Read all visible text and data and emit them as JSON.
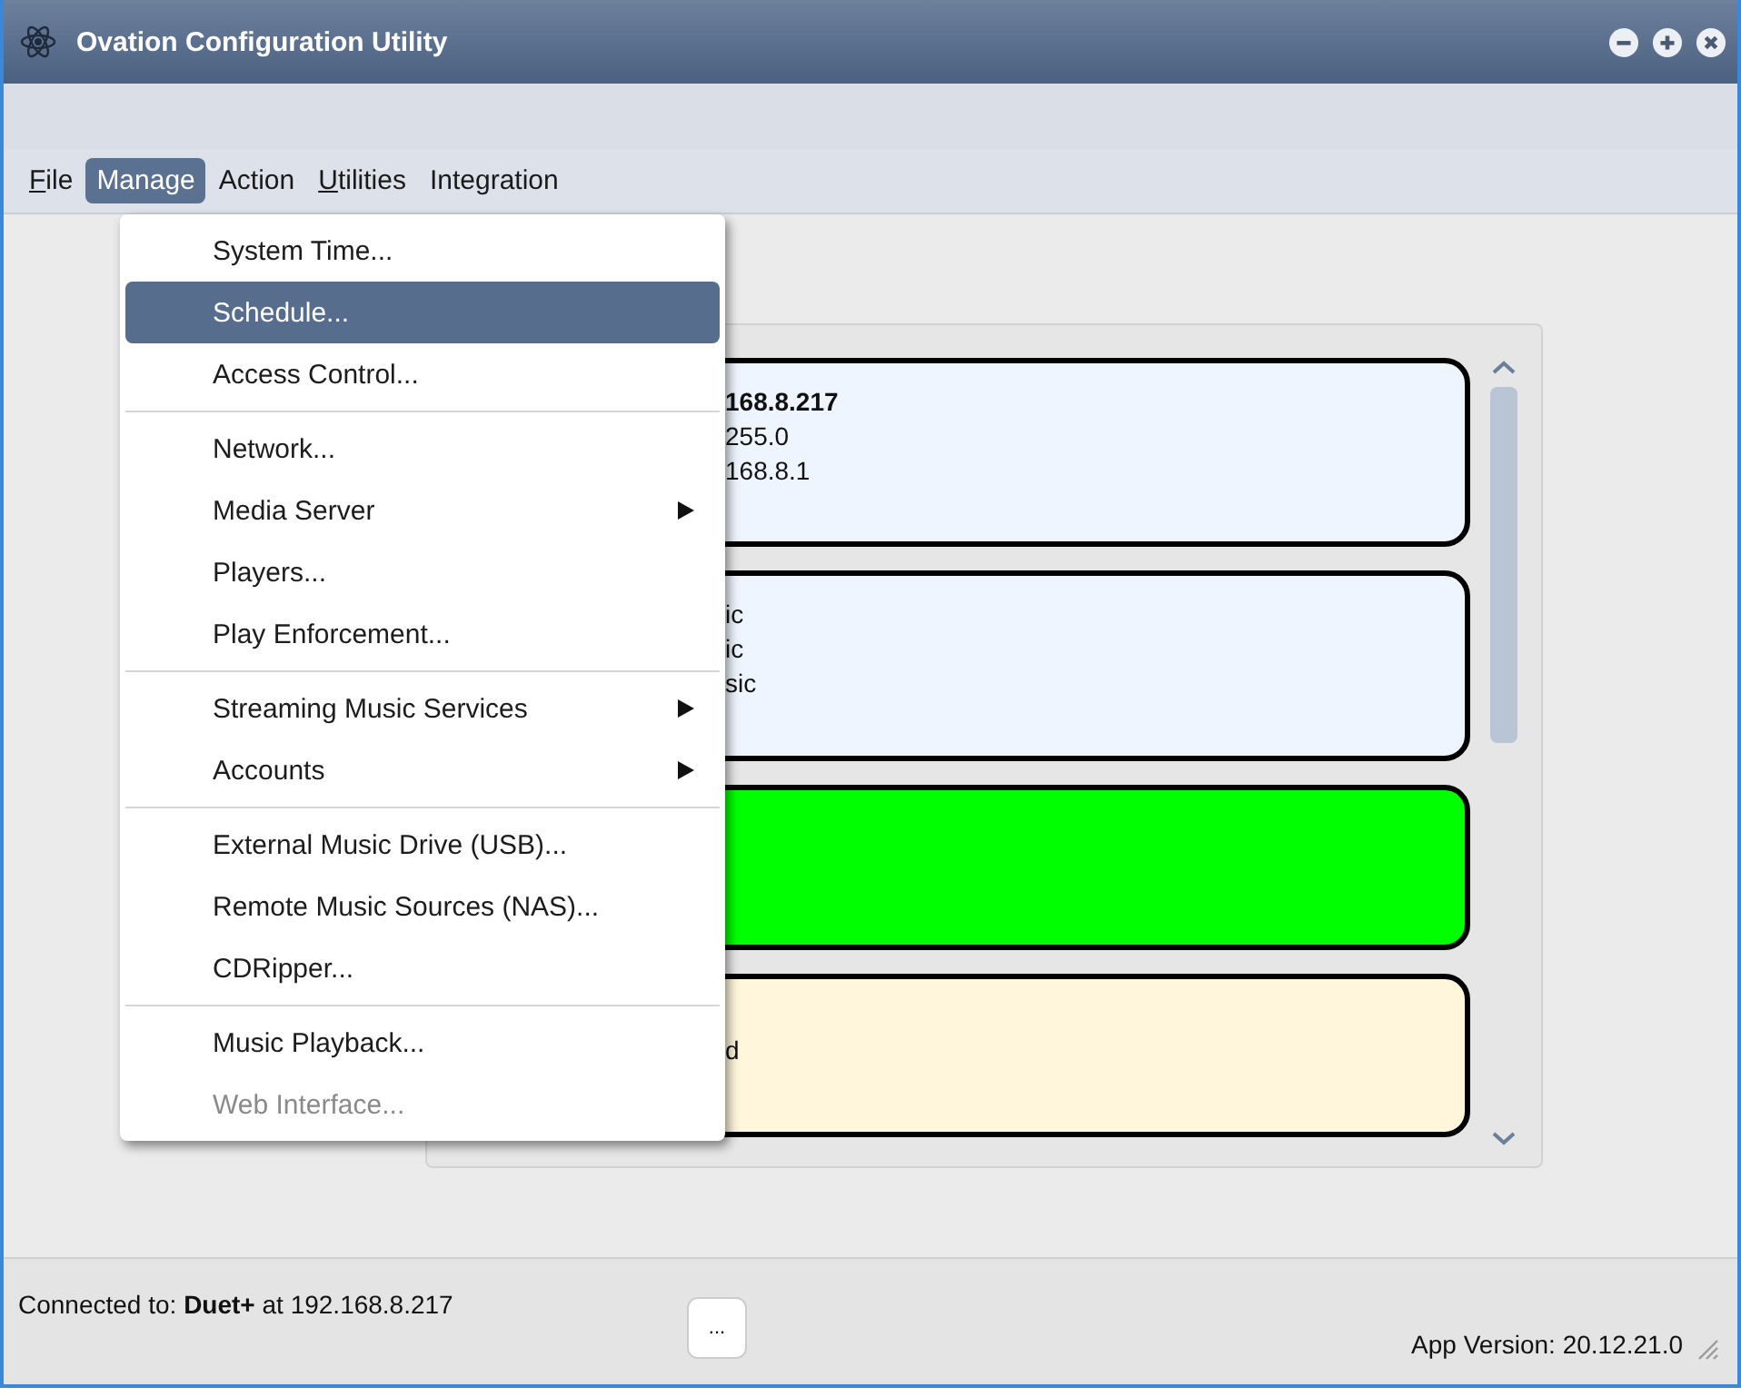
{
  "window": {
    "title": "Ovation Configuration Utility"
  },
  "menubar": [
    {
      "label": "File",
      "underlined_first": true,
      "selected": false
    },
    {
      "label": "Manage",
      "underlined_first": false,
      "selected": true
    },
    {
      "label": "Action",
      "underlined_first": false,
      "selected": false
    },
    {
      "label": "Utilities",
      "underlined_first": true,
      "selected": false
    },
    {
      "label": "Integration",
      "underlined_first": false,
      "selected": false
    }
  ],
  "menu": [
    {
      "kind": "item",
      "label": "System Time...",
      "selected": false,
      "disabled": false
    },
    {
      "kind": "item",
      "label": "Schedule...",
      "selected": true,
      "disabled": false
    },
    {
      "kind": "item",
      "label": "Access Control...",
      "selected": false,
      "disabled": false
    },
    {
      "kind": "separator"
    },
    {
      "kind": "item",
      "label": "Network...",
      "selected": false,
      "disabled": false
    },
    {
      "kind": "submenu",
      "label": "Media Server",
      "selected": false,
      "disabled": false
    },
    {
      "kind": "item",
      "label": "Players...",
      "selected": false,
      "disabled": false
    },
    {
      "kind": "item",
      "label": "Play Enforcement...",
      "selected": false,
      "disabled": false
    },
    {
      "kind": "separator"
    },
    {
      "kind": "submenu",
      "label": "Streaming Music Services",
      "selected": false,
      "disabled": false
    },
    {
      "kind": "submenu",
      "label": "Accounts",
      "selected": false,
      "disabled": false
    },
    {
      "kind": "separator"
    },
    {
      "kind": "item",
      "label": "External Music Drive (USB)...",
      "selected": false,
      "disabled": false
    },
    {
      "kind": "item",
      "label": "Remote Music Sources (NAS)...",
      "selected": false,
      "disabled": false
    },
    {
      "kind": "item",
      "label": "CDRipper...",
      "selected": false,
      "disabled": false
    },
    {
      "kind": "separator"
    },
    {
      "kind": "item",
      "label": "Music Playback...",
      "selected": false,
      "disabled": false
    },
    {
      "kind": "item",
      "label": "Web Interface...",
      "selected": false,
      "disabled": true
    }
  ],
  "cards": [
    {
      "color": "#eef5fe",
      "lines": [
        {
          "text": "168.8.217",
          "bold": true
        },
        {
          "text": "255.0",
          "bold": false
        },
        {
          "text": "168.8.1",
          "bold": false
        }
      ]
    },
    {
      "color": "#eef5fe",
      "lines": [
        {
          "text": "ic",
          "bold": false
        },
        {
          "text": "ic",
          "bold": false
        },
        {
          "text": "sic",
          "bold": false
        }
      ]
    },
    {
      "color": "#00ff00"
    },
    {
      "color": "#fff6dc",
      "lines": [
        {
          "text": "d",
          "bold": false
        }
      ]
    }
  ],
  "status_bar": {
    "connection": "Connected to: **Duet+** at 192.168.8.217",
    "more_button": "...",
    "version": "App Version: 20.12.21.0"
  }
}
